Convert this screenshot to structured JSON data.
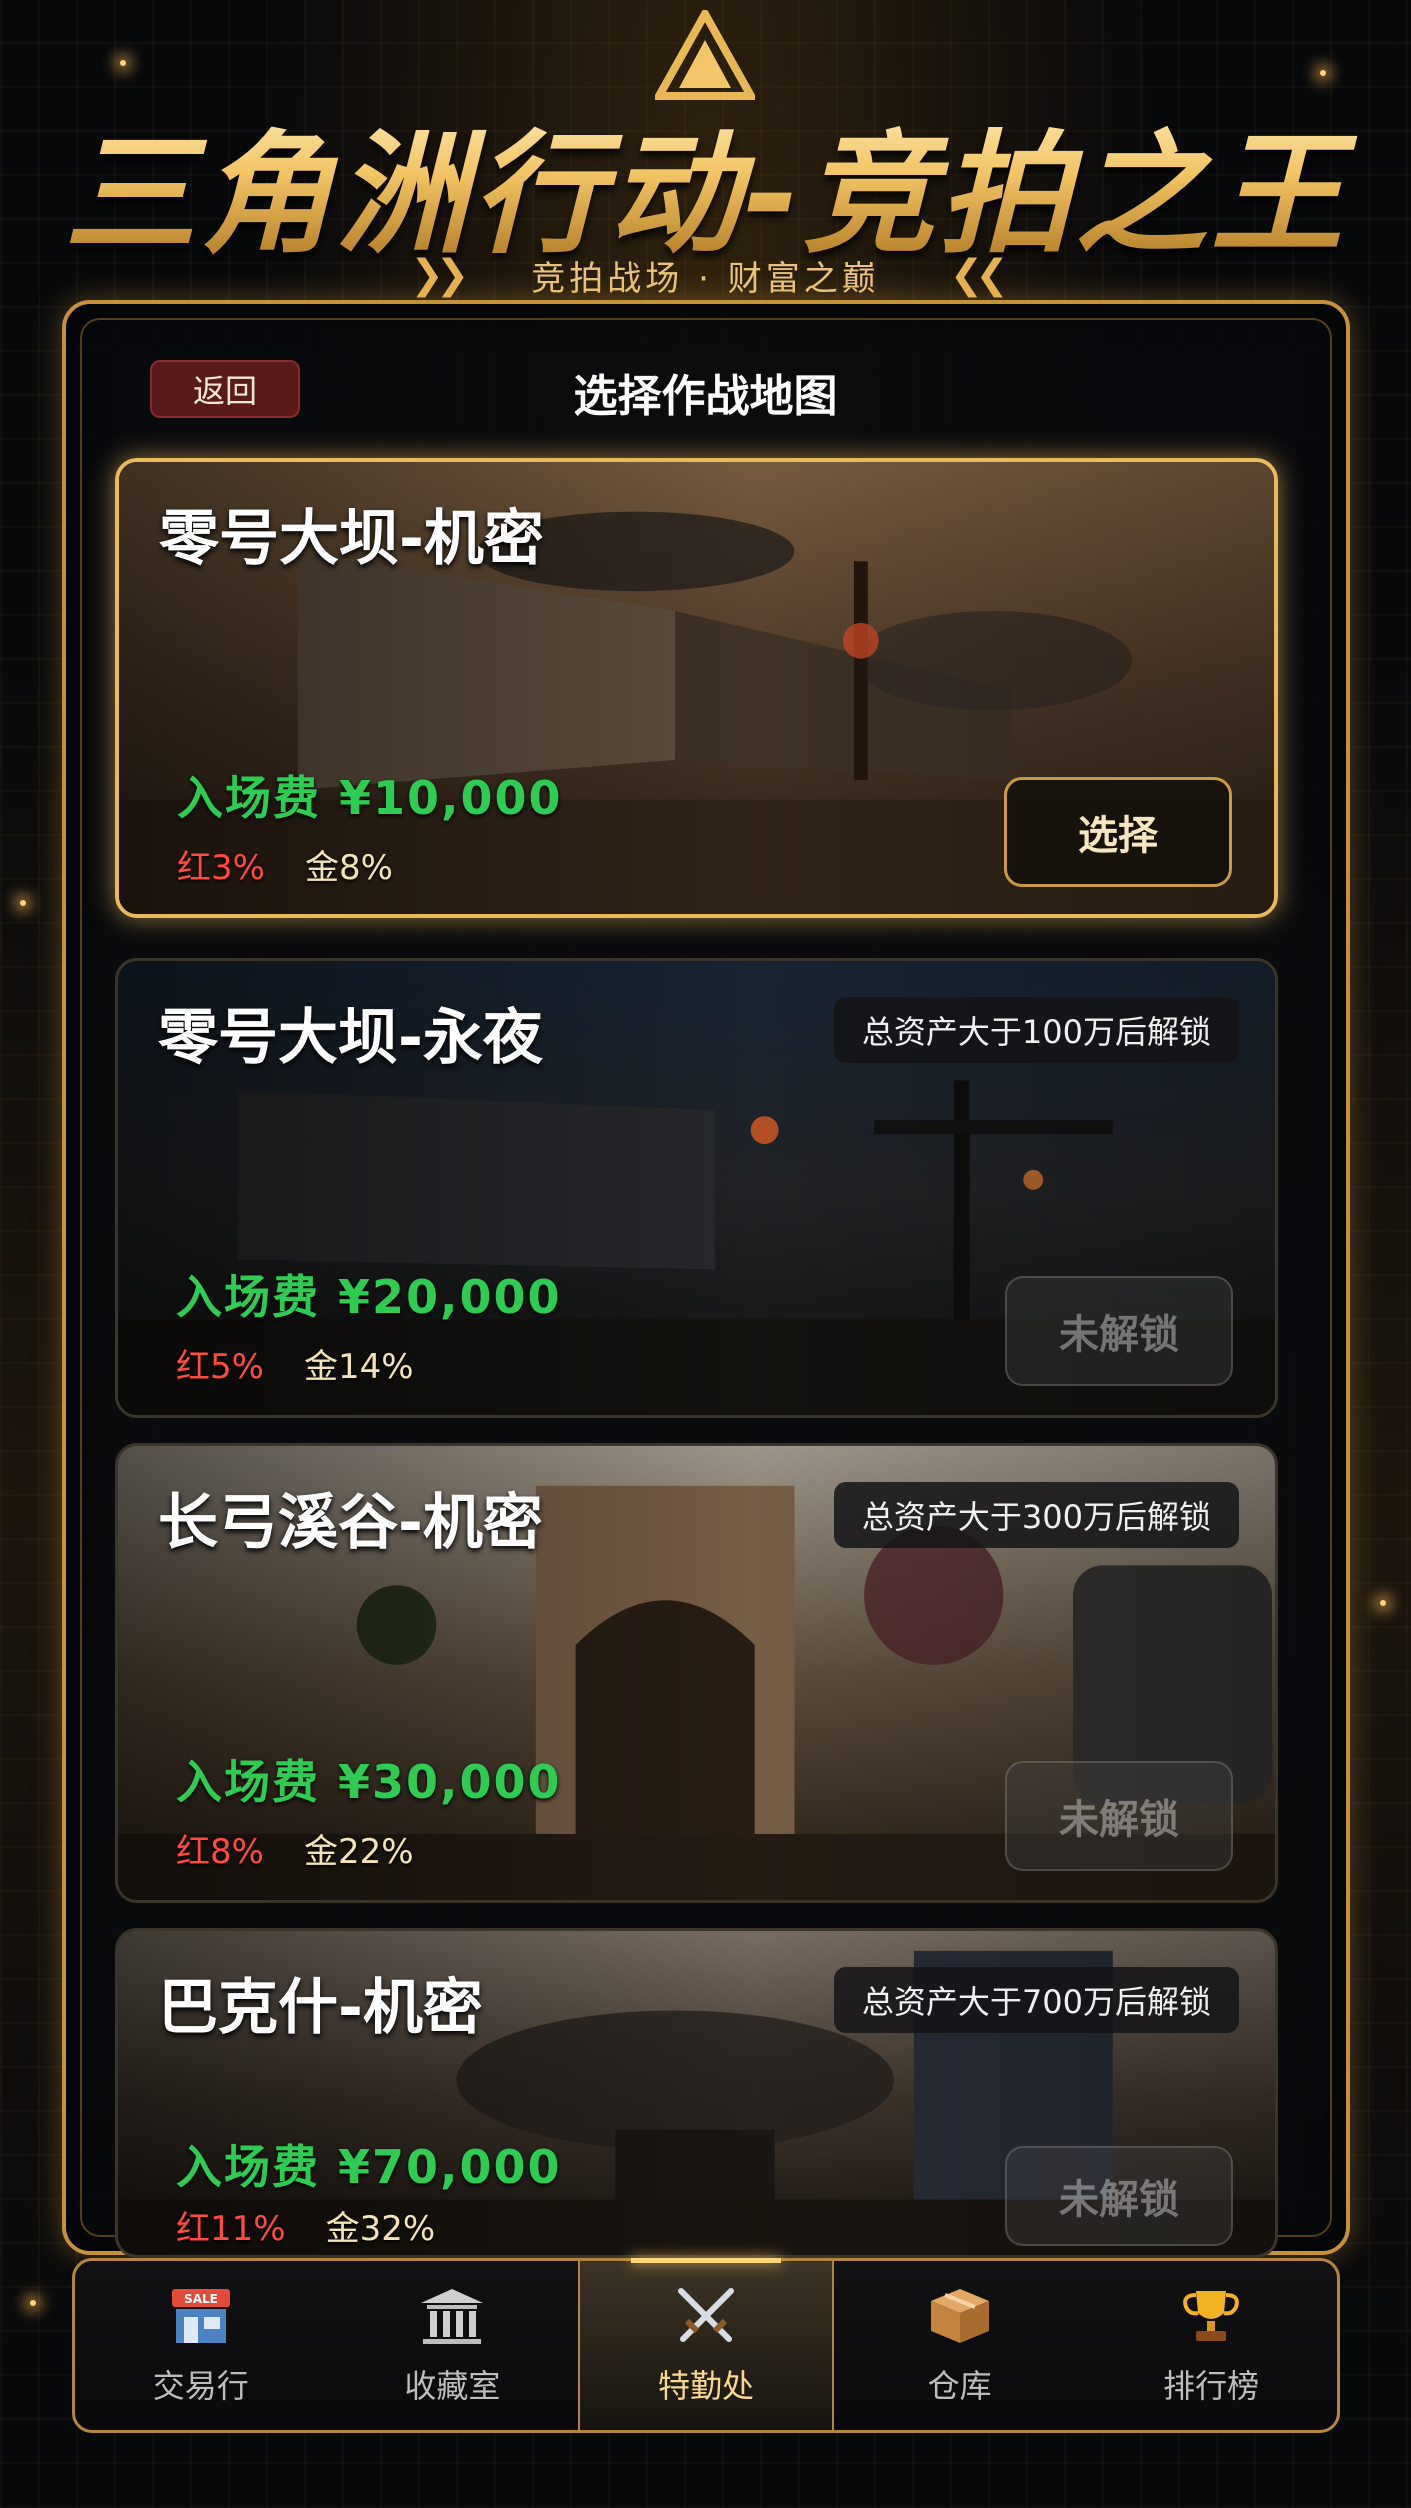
{
  "header": {
    "title": "三角洲行动-竞拍之王",
    "subtitle": "竞拍战场 · 财富之巅"
  },
  "screen": {
    "back_label": "返回",
    "title": "选择作战地图"
  },
  "maps": [
    {
      "name": "零号大坝-机密",
      "fee": "入场费 ¥10,000",
      "red_rate": "红3%",
      "gold_rate": "金8%",
      "lock_text": "",
      "button": "选择",
      "locked": false
    },
    {
      "name": "零号大坝-永夜",
      "fee": "入场费 ¥20,000",
      "red_rate": "红5%",
      "gold_rate": "金14%",
      "lock_text": "总资产大于100万后解锁",
      "button": "未解锁",
      "locked": true
    },
    {
      "name": "长弓溪谷-机密",
      "fee": "入场费 ¥30,000",
      "red_rate": "红8%",
      "gold_rate": "金22%",
      "lock_text": "总资产大于300万后解锁",
      "button": "未解锁",
      "locked": true
    },
    {
      "name": "巴克什-机密",
      "fee": "入场费 ¥70,000",
      "red_rate": "红11%",
      "gold_rate": "金32%",
      "lock_text": "总资产大于700万后解锁",
      "button": "未解锁",
      "locked": true
    }
  ],
  "nav": {
    "items": [
      {
        "label": "交易行",
        "icon": "shop-icon"
      },
      {
        "label": "收藏室",
        "icon": "museum-icon"
      },
      {
        "label": "特勤处",
        "icon": "crossed-swords-icon"
      },
      {
        "label": "仓库",
        "icon": "box-icon"
      },
      {
        "label": "排行榜",
        "icon": "trophy-icon"
      }
    ],
    "active_index": 2
  },
  "colors": {
    "gold": "#e9b95b",
    "fee_green": "#2ecc52",
    "red_rate": "#ff4a3d",
    "back_button": "#5b1a1a"
  }
}
